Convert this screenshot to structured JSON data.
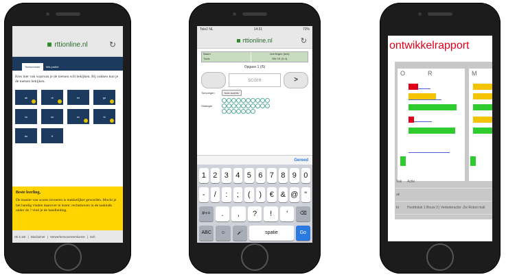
{
  "phone1": {
    "url": "rttionline.nl",
    "tabs": [
      "Toetsvenster",
      "Wis profiel"
    ],
    "instruction": "Kies hier vak waarvan je de toetsen wilt bekijken. Bij vakken kun je de toetsen bekijken.",
    "tiles": [
      "ak",
      "nl",
      "en",
      "gs",
      "fa",
      "wi",
      "ec",
      "bi",
      "du",
      "fr",
      "",
      "",
      ""
    ],
    "notice_title": "Beste leerling,",
    "notice_text": "De manier van scores invoeren is makkelijker geworden. Mocht je het handig vinden daarover te lezen: rechtsboven in de taakbalk onder de ? vind je de handleiding.",
    "footer": [
      "rtti 3.18r",
      "Disclaimer",
      "Verwerkersovereenkomst",
      "Sch"
    ]
  },
  "phone2": {
    "status_left": "Tele2 NL",
    "status_time": "14:31",
    "status_right": "72%",
    "url": "rttionline.nl",
    "info": [
      {
        "k": "Naam",
        "v": "Leerlingen (test)"
      },
      {
        "k": "Toets",
        "v": "SW H1 (5.4)"
      }
    ],
    "opgave": "Opgave 1 (/5)",
    "score_placeholder": "score",
    "next_label": ">",
    "toevoegen_label": "Toevoegen",
    "toevoegen_button": "toon scores",
    "strategie_label": "Strategie",
    "done": "Gereed",
    "keys_row1": [
      "1",
      "2",
      "3",
      "4",
      "5",
      "6",
      "7",
      "8",
      "9",
      "0"
    ],
    "keys_row2": [
      "-",
      "/",
      ":",
      ";",
      "(",
      ")",
      "€",
      "&",
      "@",
      "\""
    ],
    "keys_row3": [
      "#+=",
      ".",
      ",",
      "?",
      "!",
      "'",
      "⌫"
    ],
    "keys_row4": [
      "ABC",
      "☺",
      "🎤",
      "spatie",
      "Go"
    ]
  },
  "phone3": {
    "title": "ontwikkelrapport",
    "col_headers": [
      "O",
      "R",
      "M"
    ],
    "table": [
      {
        "c1": "Vak",
        "c2": "Actie"
      },
      {
        "c1": "ak",
        "c2": ""
      },
      {
        "c1": "bi",
        "c2": "Hoofdstuk 1 Bouw 3 | Verbeteractie: Zie Robot mail"
      }
    ],
    "link_text": "Zie Robot",
    "colors": {
      "red": "#e0001a",
      "yellow": "#f5c400",
      "green": "#2ecc2e",
      "blue": "#4a5fd0"
    }
  }
}
